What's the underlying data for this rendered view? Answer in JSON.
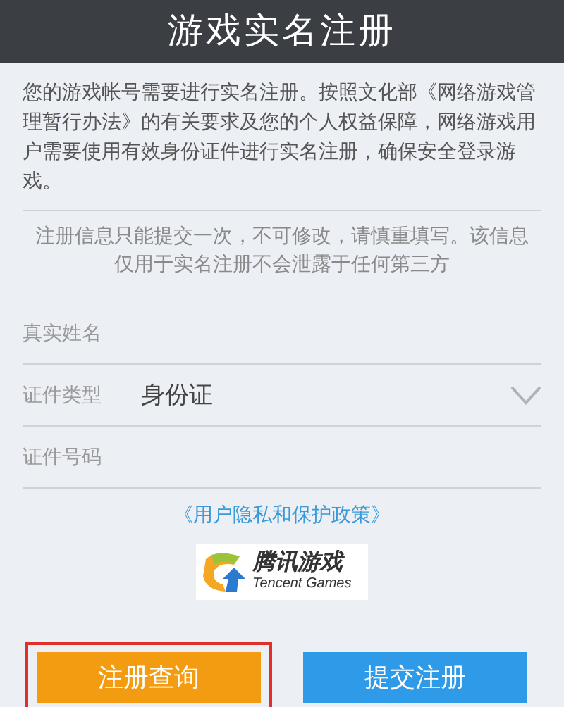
{
  "title": "游戏实名注册",
  "intro": "您的游戏帐号需要进行实名注册。按照文化部《网络游戏管理暂行办法》的有关要求及您的个人权益保障，网络游戏用户需要使用有效身份证件进行实名注册，确保安全登录游戏。",
  "notice": "注册信息只能提交一次，不可修改，请慎重填写。该信息仅用于实名注册不会泄露于任何第三方",
  "fields": [
    {
      "kind": "text",
      "label": "真实姓名"
    },
    {
      "kind": "select",
      "label": "证件类型",
      "value": "身份证"
    },
    {
      "kind": "text",
      "label": "证件号码"
    }
  ],
  "policy_link": "《用户隐私和保护政策》",
  "logo": {
    "name": "腾讯游戏",
    "subtitle": "Tencent Games"
  },
  "buttons": [
    {
      "label": "注册查询",
      "kind": "secondary",
      "highlighted": true
    },
    {
      "label": "提交注册",
      "kind": "primary",
      "highlighted": false
    }
  ]
}
